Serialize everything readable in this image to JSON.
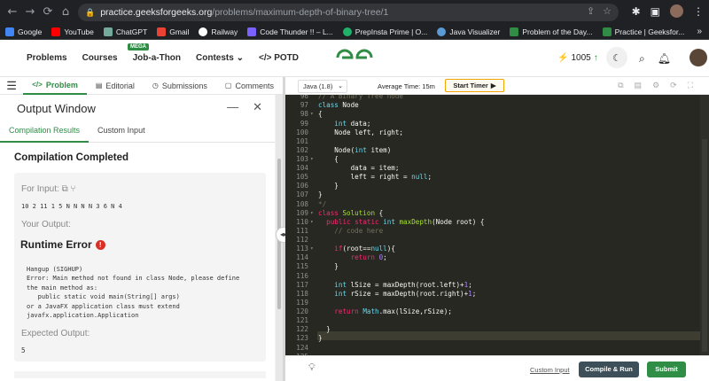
{
  "browser": {
    "url_host": "practice.geeksforgeeks.org",
    "url_path": "/problems/maximum-depth-of-binary-tree/1",
    "bookmarks": [
      {
        "label": "Google",
        "color": "#4285f4"
      },
      {
        "label": "YouTube",
        "color": "#ff0000"
      },
      {
        "label": "ChatGPT",
        "color": "#74aa9c"
      },
      {
        "label": "Gmail",
        "color": "#ea4335"
      },
      {
        "label": "Railway",
        "color": "#ffffff"
      },
      {
        "label": "Code Thunder !! – L...",
        "color": "#7b61ff"
      },
      {
        "label": "PrepInsta Prime | O...",
        "color": "#1fb26b"
      },
      {
        "label": "Java Visualizer",
        "color": "#5b9bd5"
      },
      {
        "label": "Problem of the Day...",
        "color": "#2f8d46"
      },
      {
        "label": "Practice | Geeksfor...",
        "color": "#2f8d46"
      }
    ],
    "bookmarks_more": "»"
  },
  "header": {
    "nav": [
      "Problems",
      "Courses",
      "Job-a-Thon",
      "Contests",
      "</> POTD"
    ],
    "mega_badge": "MEGA",
    "streak_value": "1005",
    "logo_color": "#2f8d46"
  },
  "problem_tabs": [
    "Problem",
    "Editorial",
    "Submissions",
    "Comments"
  ],
  "output": {
    "title": "Output Window",
    "tabs": [
      "Compilation Results",
      "Custom Input"
    ],
    "status": "Compilation Completed",
    "for_input_label": "For Input:",
    "input_value": "10 2 11 1 5 N N N N 3 6 N 4",
    "your_output_label": "Your Output:",
    "runtime_error": "Runtime Error",
    "error_text": "Hangup (SIGHUP)\nError: Main method not found in class Node, please define\nthe main method as:\n   public static void main(String[] args)\nor a JavaFX application class must extend\njavafx.application.Application",
    "expected_label": "Expected Output:",
    "expected_value": "5"
  },
  "editor": {
    "language": "Java (1.8)",
    "avg_time": "Average Time: 15m",
    "timer_label": "Start Timer",
    "custom_input_link": "Custom Input",
    "compile_label": "Compile & Run",
    "submit_label": "Submit"
  }
}
